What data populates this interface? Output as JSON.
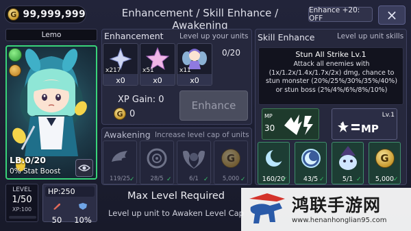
{
  "header": {
    "gold": "99,999,999",
    "gold_symbol": "G",
    "title": "Enhancement / Skill Enhance / Awakening",
    "enhance20_label": "Enhance +20: OFF",
    "close_label": "×"
  },
  "character": {
    "name": "Lemo",
    "limit_break": "LB.0/20",
    "stat_boost": "0% Stat Boost",
    "level_label": "LEVEL",
    "level": "1/50",
    "xp": "XP:100",
    "hp": "HP:250",
    "attack": "50",
    "defense": "10%"
  },
  "enhancement": {
    "title": "Enhancement",
    "subtitle": "Level up your units",
    "slot_count": "0/20",
    "materials": [
      {
        "name": "silver-star",
        "count": "x217",
        "use": "x0"
      },
      {
        "name": "pink-star",
        "count": "x51",
        "use": "x0"
      },
      {
        "name": "fairy-unit",
        "count": "x11",
        "use": "x0"
      }
    ],
    "xp_gain": "XP Gain: 0",
    "gold_cost": "0",
    "button_label": "Enhance"
  },
  "awakening": {
    "title": "Awakening",
    "subtitle": "Increase level cap of units",
    "materials": [
      {
        "name": "wing-fragment",
        "value": "119/25"
      },
      {
        "name": "ring-orb",
        "value": "28/5"
      },
      {
        "name": "shield-emblem",
        "value": "6/1"
      },
      {
        "name": "gold-coin",
        "value": "5,000"
      }
    ],
    "max_level": "Max Level Required",
    "note": "Level up unit to Awaken Level Cap"
  },
  "skill": {
    "title": "Skill Enhance",
    "subtitle": "Level up unit skills",
    "name": "Stun All Strike Lv.1",
    "description": "Attack all enemies with (1x/1.2x/1.4x/1.7x/2x) dmg, chance to stun monster (20%/25%/30%/35%/40%) or stun boss (2%/4%/6%/8%/10%)",
    "mp_label": "MP",
    "mp_value": "30",
    "lv_tag": "Lv.1",
    "materials": [
      {
        "name": "crescent-moon",
        "value": "160/20"
      },
      {
        "name": "moon-orb",
        "value": "43/5"
      },
      {
        "name": "wizard-plush",
        "value": "5/1"
      },
      {
        "name": "gold-coin",
        "value": "5,000"
      }
    ]
  },
  "watermark": {
    "title": "鸿联手游网",
    "url": "www.henanhonglian95.com"
  },
  "colors": {
    "accent_green": "#39d47a",
    "panel": "#26283d",
    "background": "#181a2a"
  }
}
